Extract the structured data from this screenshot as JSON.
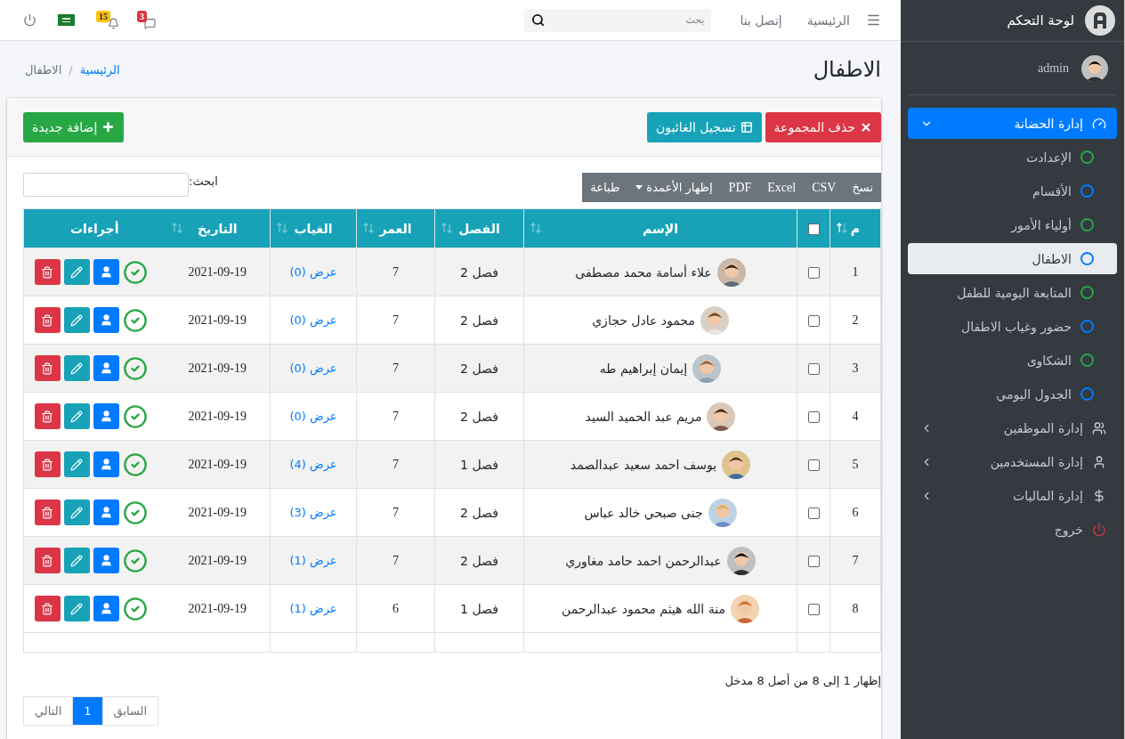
{
  "topbar": {
    "nav_links": [
      "الرئيسية",
      "إتصل بنا"
    ],
    "search": {
      "placeholder": "بحث"
    },
    "badges": [
      {
        "count": "3",
        "color": "#dc3545"
      },
      {
        "count": "15",
        "color": "#ffc107"
      }
    ]
  },
  "page": {
    "title": "الاطفال",
    "breadcrumb_separator": "/",
    "breadcrumb": [
      {
        "label": "الرئيسية",
        "selected": false
      },
      {
        "label": "الاطفال",
        "selected": true
      }
    ]
  },
  "card_actions": [
    {
      "label": "حذف المجموعة",
      "color": "#dc3545"
    },
    {
      "label": "تسجيل الغائبون",
      "color": "#17a2b8"
    }
  ],
  "add_button": {
    "label": "إضافة جديدة"
  },
  "export_buttons": [
    {
      "label": "نسخ",
      "kind": "button"
    },
    {
      "label": "CSV",
      "kind": "button"
    },
    {
      "label": "Excel",
      "kind": "button"
    },
    {
      "label": "PDF",
      "kind": "button"
    },
    {
      "label": "إظهار الأعمدة",
      "kind": "dropdown"
    },
    {
      "label": "طباعة",
      "kind": "button"
    }
  ],
  "table_search": {
    "label": "ابحث:"
  },
  "table": {
    "columns": [
      {
        "label": "م",
        "kind": "sortable",
        "sorted": true
      },
      {
        "kind": "checkbox",
        "checked": false
      },
      {
        "label": "الإسم",
        "kind": "sortable",
        "sorted": false
      },
      {
        "label": "الفصل",
        "kind": "sortable",
        "sorted": false
      },
      {
        "label": "العمر",
        "kind": "sortable",
        "sorted": false
      },
      {
        "label": "الغياب",
        "kind": "sortable",
        "sorted": false
      },
      {
        "label": "التاريخ",
        "kind": "sortable",
        "sorted": false
      },
      {
        "label": "أجراءات",
        "kind": "plain"
      }
    ],
    "rows": [
      {
        "index": "1",
        "checked": false,
        "name": "علاء أسامة محمد مصطفى",
        "class": "فصل 2",
        "age": "7",
        "absence": "عرض (0)",
        "date": "2021-09-19"
      },
      {
        "index": "2",
        "checked": false,
        "name": "محمود عادل حجازي",
        "class": "فصل 2",
        "age": "7",
        "absence": "عرض (0)",
        "date": "2021-09-19"
      },
      {
        "index": "3",
        "checked": false,
        "name": "إيمان إبراهيم طه",
        "class": "فصل 2",
        "age": "7",
        "absence": "عرض (0)",
        "date": "2021-09-19"
      },
      {
        "index": "4",
        "checked": false,
        "name": "مريم عبد الحميد السيد",
        "class": "فصل 2",
        "age": "7",
        "absence": "عرض (0)",
        "date": "2021-09-19"
      },
      {
        "index": "5",
        "checked": false,
        "name": "يوسف احمد سعيد عبدالصمد",
        "class": "فصل 1",
        "age": "7",
        "absence": "عرض (4)",
        "date": "2021-09-19"
      },
      {
        "index": "6",
        "checked": false,
        "name": "جنى صبحي خالد عباس",
        "class": "فصل 2",
        "age": "7",
        "absence": "عرض (3)",
        "date": "2021-09-19"
      },
      {
        "index": "7",
        "checked": false,
        "name": "عبدالرحمن احمد حامد مغاوري",
        "class": "فصل 2",
        "age": "7",
        "absence": "عرض (1)",
        "date": "2021-09-19"
      },
      {
        "index": "8",
        "checked": false,
        "name": "منة الله هيثم محمود عبدالرحمن",
        "class": "فصل 1",
        "age": "6",
        "absence": "عرض (1)",
        "date": "2021-09-19"
      }
    ]
  },
  "info": "إظهار 1 إلى 8 من أصل 8 مدخل",
  "pagination": [
    {
      "label": "السابق",
      "selected": false
    },
    {
      "label": "1",
      "selected": true
    },
    {
      "label": "التالي",
      "selected": false
    }
  ],
  "sidebar": {
    "brand": "لوحة التحكم",
    "user": "admin",
    "menu": [
      {
        "label": "إدارة الحضانة",
        "kind": "group",
        "selected": true,
        "expanded": true,
        "children": [
          {
            "label": "الإعدادت",
            "color": "#28a745",
            "selected": false
          },
          {
            "label": "الأقسام",
            "color": "#007bff",
            "selected": false
          },
          {
            "label": "أولياء الأمور",
            "color": "#28a745",
            "selected": false
          },
          {
            "label": "الاطفال",
            "color": "#007bff",
            "selected": true
          },
          {
            "label": "المتابعة اليومية للطفل",
            "color": "#28a745",
            "selected": false
          },
          {
            "label": "حضور وغياب الاطفال",
            "color": "#007bff",
            "selected": false
          },
          {
            "label": "الشكاوى",
            "color": "#28a745",
            "selected": false
          },
          {
            "label": "الجدول اليومي",
            "color": "#007bff",
            "selected": false
          }
        ]
      },
      {
        "label": "إدارة الموظفين",
        "kind": "group",
        "selected": false,
        "expanded": false
      },
      {
        "label": "إدارة المستخدمين",
        "kind": "group",
        "selected": false,
        "expanded": false
      },
      {
        "label": "إدارة الماليات",
        "kind": "group",
        "selected": false,
        "expanded": false
      },
      {
        "label": "خروج",
        "kind": "logout",
        "selected": false
      }
    ]
  }
}
